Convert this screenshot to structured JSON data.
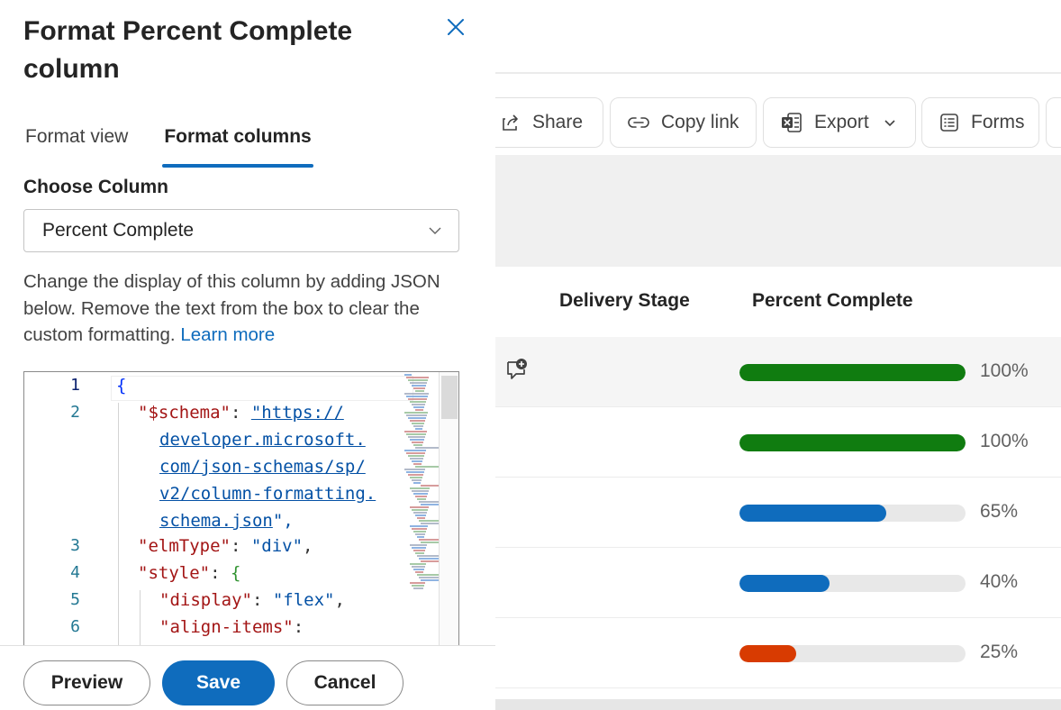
{
  "pane": {
    "title": "Format Percent Complete column",
    "tabs": [
      {
        "label": "Format view",
        "active": false
      },
      {
        "label": "Format columns",
        "active": true
      }
    ],
    "choose_column_label": "Choose Column",
    "selected_column": "Percent Complete",
    "help_text": "Change the display of this column by adding JSON below. Remove the text from the box to clear the custom formatting.",
    "learn_more": "Learn more",
    "editor": {
      "line_numbers": [
        "1",
        "2",
        "3",
        "4",
        "5",
        "6"
      ],
      "tokens": {
        "open_brace": "{",
        "schema_key": "\"$schema\"",
        "colon": ": ",
        "schema_url_1": "\"https://",
        "schema_url_2": "developer.microsoft.",
        "schema_url_3": "com/json-schemas/sp/",
        "schema_url_4": "v2/column-formatting.",
        "schema_url_5": "schema.json",
        "schema_url_end": "\",",
        "elmtype_key": "\"elmType\"",
        "elmtype_val": "\"div\"",
        "comma": ",",
        "style_key": "\"style\"",
        "style_open": "{",
        "display_key": "\"display\"",
        "display_val": "\"flex\"",
        "align_key": "\"align-items\"",
        "align_colon": ":"
      }
    },
    "buttons": {
      "preview": "Preview",
      "save": "Save",
      "cancel": "Cancel"
    }
  },
  "toolbar": {
    "share": "Share",
    "copy_link": "Copy link",
    "export": "Export",
    "forms": "Forms"
  },
  "list": {
    "columns": [
      "Delivery Stage",
      "Percent Complete"
    ],
    "rows": [
      {
        "percent": 100,
        "label": "100%",
        "color": "#107c10",
        "has_comment_icon": true
      },
      {
        "percent": 100,
        "label": "100%",
        "color": "#107c10",
        "has_comment_icon": false
      },
      {
        "percent": 65,
        "label": "65%",
        "color": "#0f6cbd",
        "has_comment_icon": false
      },
      {
        "percent": 40,
        "label": "40%",
        "color": "#0f6cbd",
        "has_comment_icon": false
      },
      {
        "percent": 25,
        "label": "25%",
        "color": "#d83b01",
        "has_comment_icon": false
      }
    ]
  },
  "colors": {
    "accent": "#0f6cbd",
    "complete": "#107c10",
    "in_progress": "#0f6cbd",
    "behind": "#d83b01"
  },
  "icons": [
    "close-icon",
    "chevron-down-icon",
    "share-icon",
    "link-icon",
    "excel-icon",
    "forms-icon",
    "comment-add-icon"
  ]
}
